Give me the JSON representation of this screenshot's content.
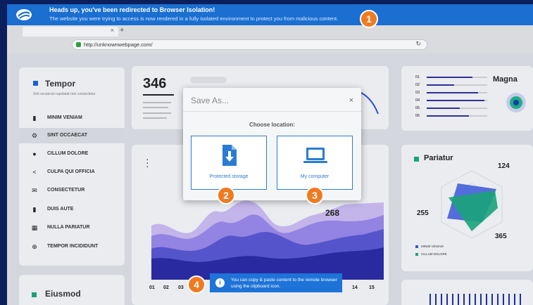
{
  "banner": {
    "title": "Heads up, you've been redirected to Browser Isolation!",
    "subtitle": "The website you were trying to access is now rendered in a fully isolated environment to protect you from malicious content.",
    "color": "#1a6fd0"
  },
  "browser": {
    "tab_close": "×",
    "new_tab": "+",
    "url": "http://unknownwebpage.com/",
    "reload_icon": "↻"
  },
  "sidebar": {
    "title": "Tempor",
    "subtitle": "Sint occaecat cupidatat non consectetur",
    "items": [
      {
        "label": "MINIM VENIAM",
        "icon": "briefcase-icon",
        "glyph": "▮"
      },
      {
        "label": "SINT OCCAECAT",
        "icon": "gear-icon",
        "glyph": "⚙",
        "active": true
      },
      {
        "label": "CILLUM DOLORE",
        "icon": "info-icon",
        "glyph": "●"
      },
      {
        "label": "CULPA QUI OFFICIA",
        "icon": "share-icon",
        "glyph": "<"
      },
      {
        "label": "CONSECTETUR",
        "icon": "mail-icon",
        "glyph": "✉"
      },
      {
        "label": "DUIS AUTE",
        "icon": "bar-chart-icon",
        "glyph": "▮"
      },
      {
        "label": "NULLA PARIATUR",
        "icon": "calculator-icon",
        "glyph": "▦"
      },
      {
        "label": "TEMPOR INCIDIDUNT",
        "icon": "globe-icon",
        "glyph": "⊕"
      }
    ]
  },
  "eiusmod": {
    "title": "Eiusmod"
  },
  "stat": {
    "value": "346"
  },
  "chart": {
    "x_labels": [
      "01",
      "02",
      "03",
      "14",
      "15"
    ],
    "value_268": "268"
  },
  "bars_card": {
    "title": "Magna",
    "rows": [
      {
        "label": "01",
        "fill": 0.75
      },
      {
        "label": "02",
        "fill": 0.45
      },
      {
        "label": "03",
        "fill": 0.85
      },
      {
        "label": "04",
        "fill": 0.95
      },
      {
        "label": "05",
        "fill": 0.55
      },
      {
        "label": "06",
        "fill": 0.7
      }
    ]
  },
  "pariatur": {
    "title": "Pariatur",
    "n1": "124",
    "n2": "255",
    "n3": "365",
    "legend": [
      "MINIM VENIAM",
      "CILLUM DOLORE"
    ]
  },
  "dialog": {
    "title": "Save As...",
    "close": "×",
    "choose_label": "Choose location:",
    "option_storage": "Protected storage",
    "option_computer": "My computer"
  },
  "badges": [
    "1",
    "2",
    "3",
    "4"
  ],
  "toast": {
    "icon_glyph": "i",
    "text": "You can copy & paste content to the remote browser using the clipboard icon."
  }
}
